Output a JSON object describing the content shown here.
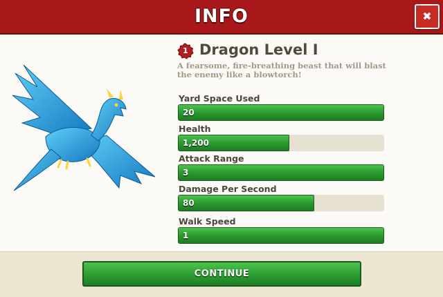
{
  "header": {
    "title": "INFO",
    "close_label": "✖"
  },
  "troop": {
    "level_number": "1",
    "name": "Dragon Level I",
    "description": "A fearsome, fire-breathing beast that will blast the enemy like a blowtorch!"
  },
  "stats": [
    {
      "label": "Yard Space Used",
      "value": "20",
      "fill_fraction": 1.0
    },
    {
      "label": "Health",
      "value": "1,200",
      "fill_fraction": 0.54
    },
    {
      "label": "Attack Range",
      "value": "3",
      "fill_fraction": 1.0
    },
    {
      "label": "Damage Per Second",
      "value": "80",
      "fill_fraction": 0.66
    },
    {
      "label": "Walk Speed",
      "value": "1",
      "fill_fraction": 1.0
    }
  ],
  "footer": {
    "continue_label": "CONTINUE"
  },
  "colors": {
    "header": "#a8181a",
    "bar_green": "#2a9a2e",
    "dragon_blue": "#2fa6e3"
  }
}
